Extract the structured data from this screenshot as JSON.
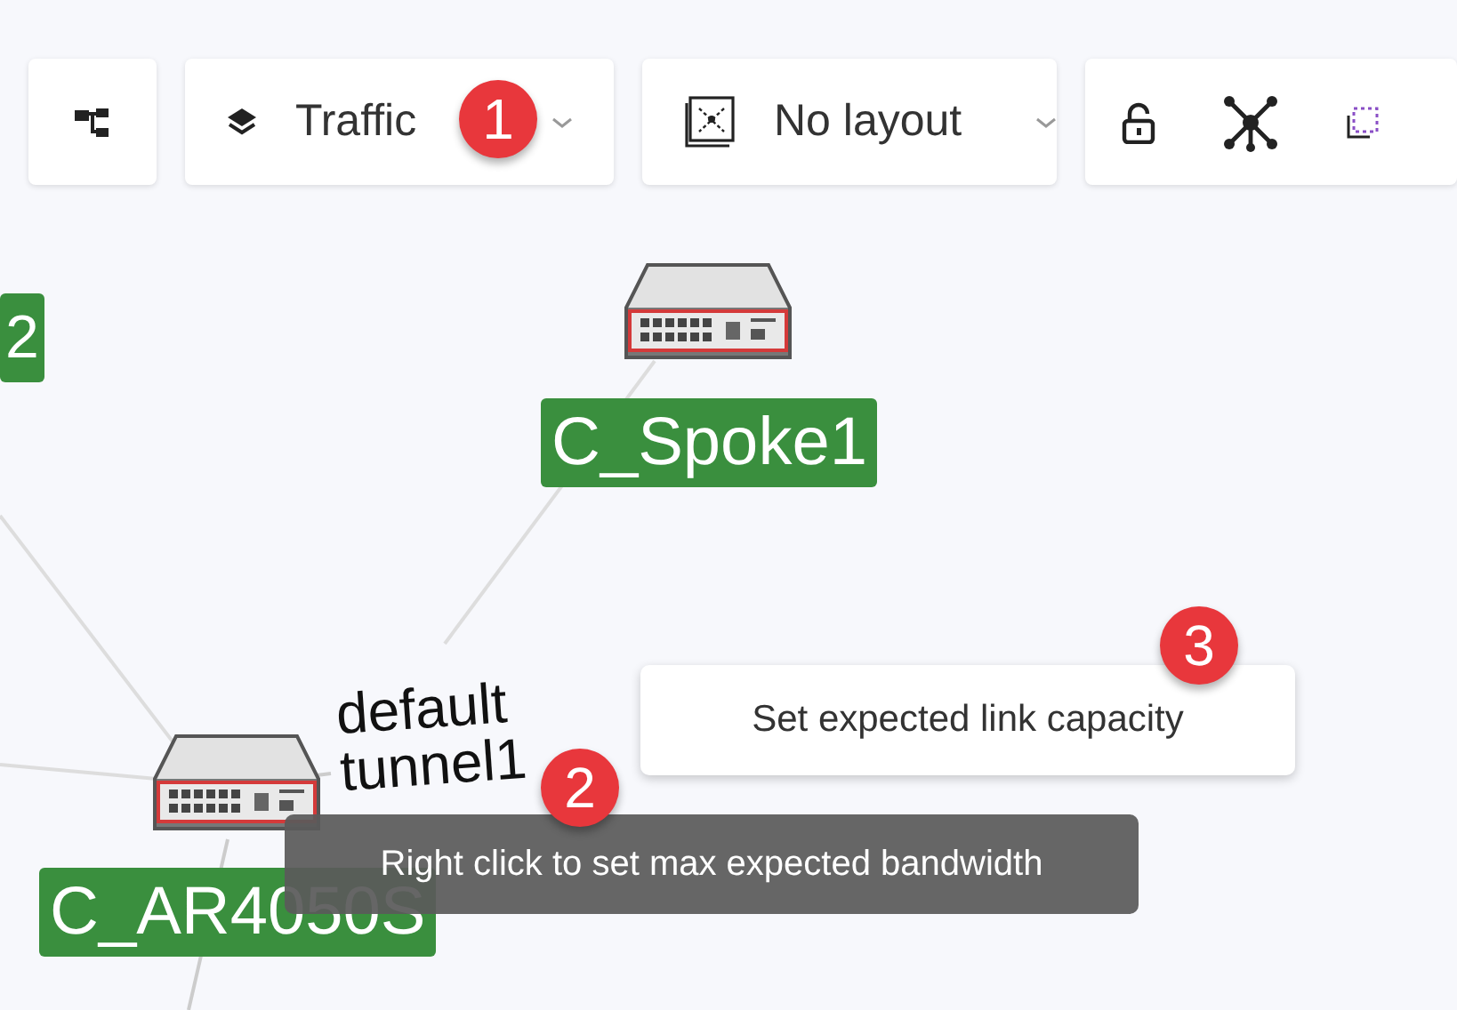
{
  "toolbar": {
    "dropdowns": [
      {
        "label": "Traffic"
      },
      {
        "label": "No layout"
      }
    ]
  },
  "diagram": {
    "nodes": [
      {
        "kind": "label-only",
        "label": "2"
      },
      {
        "kind": "router",
        "label": "C_Spoke1"
      },
      {
        "kind": "router",
        "label": "C_AR4050S"
      }
    ],
    "link_label": [
      "default",
      "tunnel1"
    ]
  },
  "context_menu": {
    "items": [
      "Set expected link capacity"
    ]
  },
  "tooltip": "Right click to set max expected bandwidth",
  "callouts": [
    "1",
    "2",
    "3"
  ]
}
